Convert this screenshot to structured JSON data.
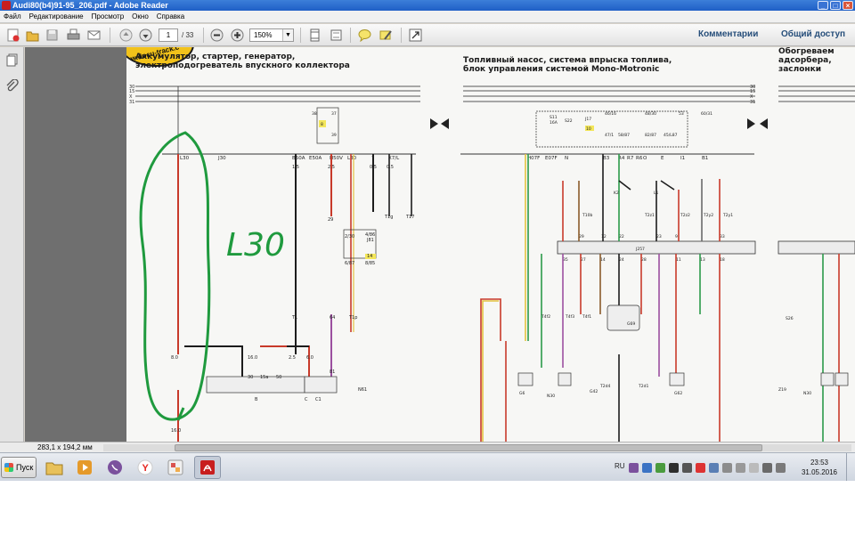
{
  "window": {
    "title": "Audi80(b4)91-95_206.pdf - Adobe Reader",
    "controls": [
      "_",
      "□",
      "×"
    ]
  },
  "menu": [
    "Файл",
    "Редактирование",
    "Просмотр",
    "Окно",
    "Справка"
  ],
  "toolbar": {
    "page_current": "1",
    "page_total": "/ 33",
    "zoom": "150%",
    "comments": "Комментарии",
    "share": "Общий доступ"
  },
  "document": {
    "logo_text": "w.docu-track.c",
    "sections": [
      {
        "text": "Аккумулятор, стартер, генератор,\nэлектроподогреватель впускного коллектора"
      },
      {
        "text": "Топливный насос, система впрыска топлива,\nблок управления системой Mono-Motronic"
      },
      {
        "text": "Обогреваем\nадсорбера,\nзаслонки"
      }
    ],
    "rails": [
      "30",
      "15",
      "X",
      "31"
    ],
    "rails_right": [
      "30",
      "15",
      "X",
      "31"
    ],
    "labels": {
      "l30": "L30",
      "j30": "J30",
      "bus_left": [
        "B50A",
        "E50A",
        "H50V",
        "L30",
        "7",
        "TP",
        "X7/L"
      ],
      "bus_mid": [
        "H07F",
        "E07F",
        "N",
        "B3",
        "R4",
        "R7",
        "R6",
        "O",
        "E",
        "I1",
        "B1"
      ],
      "relay": [
        "S11",
        "16A",
        "S22",
        "J17",
        "10",
        "46/16",
        "48/30",
        "53",
        "60/31",
        "47/1",
        "58/87",
        "82/87",
        "45/L87"
      ],
      "fuse_left": [
        "38",
        "8",
        "37",
        "39"
      ],
      "wire_values": [
        "1.5",
        "0.5",
        "0.5",
        "1.0",
        "2.5",
        "1.5",
        "0.5"
      ],
      "components_left": [
        "B",
        "C",
        "C1",
        "N61",
        "T1",
        "T1p",
        "64",
        "81",
        "29",
        "J81",
        "14",
        "2/30",
        "4/86",
        "6/87",
        "8/85",
        "50",
        "15a",
        "30",
        "16.0",
        "2.5",
        "6.0",
        "8.0",
        "16.0",
        "T1g",
        "T17"
      ],
      "components_mid": [
        "G6",
        "N30",
        "G42",
        "G69",
        "G62",
        "T2d1",
        "T2d4",
        "T4f1",
        "T4f3",
        "T4f2",
        "J257",
        "T10b",
        "T2z1",
        "T2z2",
        "T2y2",
        "T2y1",
        "K2",
        "L1",
        "G39",
        "G40"
      ],
      "pin_numbers": [
        "29",
        "12",
        "22",
        "23",
        "9",
        "33",
        "35",
        "27",
        "14",
        "24",
        "28",
        "11",
        "13",
        "18",
        "26",
        "35"
      ],
      "components_right": [
        "F33",
        "N30",
        "Z19",
        "S26",
        "T2"
      ]
    },
    "annotation": "L30"
  },
  "status": {
    "dimensions": "283,1 x 194,2 мм"
  },
  "taskbar": {
    "start": "Пуск",
    "lang": "RU",
    "time": "23:53",
    "date": "31.05.2016"
  }
}
